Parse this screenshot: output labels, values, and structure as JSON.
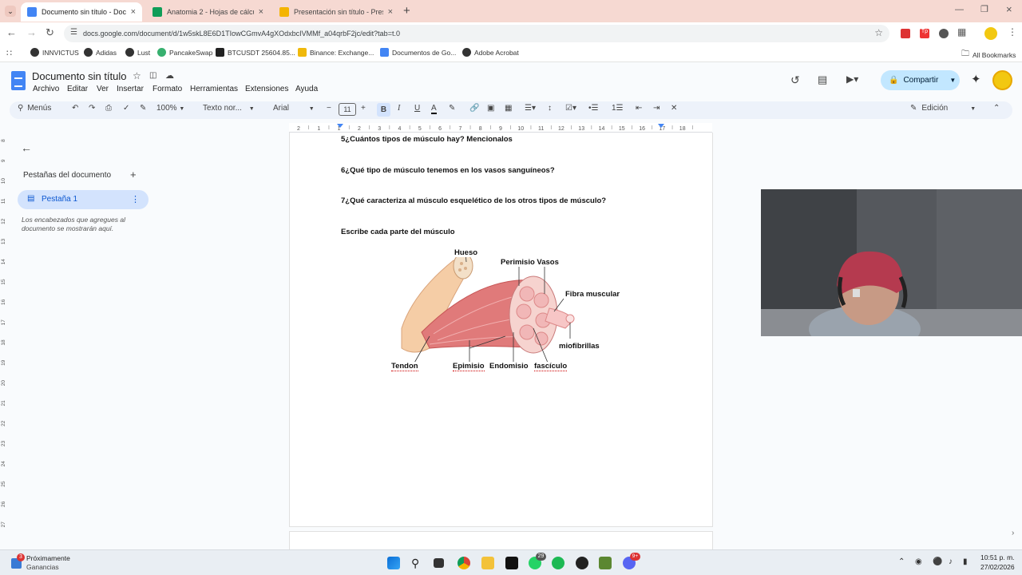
{
  "browser": {
    "tabs": [
      {
        "label": "Documento sin título - Docume",
        "color": "#4285f4",
        "active": true
      },
      {
        "label": "Anatomia 2 - Hojas de cálculo",
        "color": "#0f9d58",
        "active": false
      },
      {
        "label": "Presentación sin título - Prese",
        "color": "#f4b400",
        "active": false
      }
    ],
    "url": "docs.google.com/document/d/1w5skL8E6D1TIowCGmvA4gXOdxbcIVMMf_a04qrbF2jc/edit?tab=t.0",
    "bookmarks": [
      {
        "label": "INNVICTUS",
        "color": "#333333"
      },
      {
        "label": "Adidas",
        "color": "#333333"
      },
      {
        "label": "Lust",
        "color": "#333333"
      },
      {
        "label": "PancakeSwap",
        "color": "#37b06f"
      },
      {
        "label": "BTCUSDT 25604.85...",
        "color": "#222222"
      },
      {
        "label": "Binance: Exchange...",
        "color": "#f0b90b"
      },
      {
        "label": "Documentos de Go...",
        "color": "#4285f4"
      },
      {
        "label": "Adobe Acrobat",
        "color": "#333333"
      }
    ],
    "all_bookmarks": "All Bookmarks"
  },
  "docs": {
    "title": "Documento sin título",
    "menu": [
      "Archivo",
      "Editar",
      "Ver",
      "Insertar",
      "Formato",
      "Herramientas",
      "Extensiones",
      "Ayuda"
    ],
    "share_label": "Compartir",
    "toolbar": {
      "menus_label": "Menús",
      "zoom": "100%",
      "style": "Texto nor...",
      "font": "Arial",
      "font_size": "11",
      "mode": "Edición"
    },
    "tabs_panel": {
      "heading": "Pestañas del documento",
      "tab_name": "Pestaña 1",
      "hint": "Los encabezados que agregues al documento se mostrarán aquí."
    },
    "ruler_ticks": [
      "2",
      "1",
      "1",
      "2",
      "3",
      "4",
      "5",
      "6",
      "7",
      "8",
      "9",
      "10",
      "11",
      "12",
      "13",
      "14",
      "15",
      "16",
      "17",
      "18"
    ],
    "left_ruler_ticks": [
      "8",
      "9",
      "10",
      "11",
      "12",
      "13",
      "14",
      "15",
      "16",
      "17",
      "18",
      "19",
      "20",
      "21",
      "22",
      "23",
      "24",
      "25",
      "26",
      "27"
    ],
    "content": {
      "questions": [
        "5¿Cuántos tipos de músculo hay? Mencionalos",
        "6¿Qué tipo de músculo tenemos en los vasos sanguíneos?",
        "7¿Qué caracteriza al músculo esquelético de los otros tipos de músculo?",
        "Escribe cada parte del músculo"
      ],
      "diagram_labels": {
        "hueso": "Hueso",
        "perimisio": "Perimisio Vasos",
        "fibra": "Fibra muscular",
        "miofibrillas": "miofibrillas",
        "tendon": "Tendon",
        "epimisio": "Epimisio",
        "endomisio": "Endomisio",
        "fasciculo": "fascículo"
      }
    }
  },
  "taskbar": {
    "widget_title": "Próximamente",
    "widget_sub": "Ganancias",
    "widget_badge": "3",
    "whatsapp_badge": "29",
    "discord_badge": "9+",
    "time": "10:51 p. m.",
    "date": "27/02/2026"
  }
}
